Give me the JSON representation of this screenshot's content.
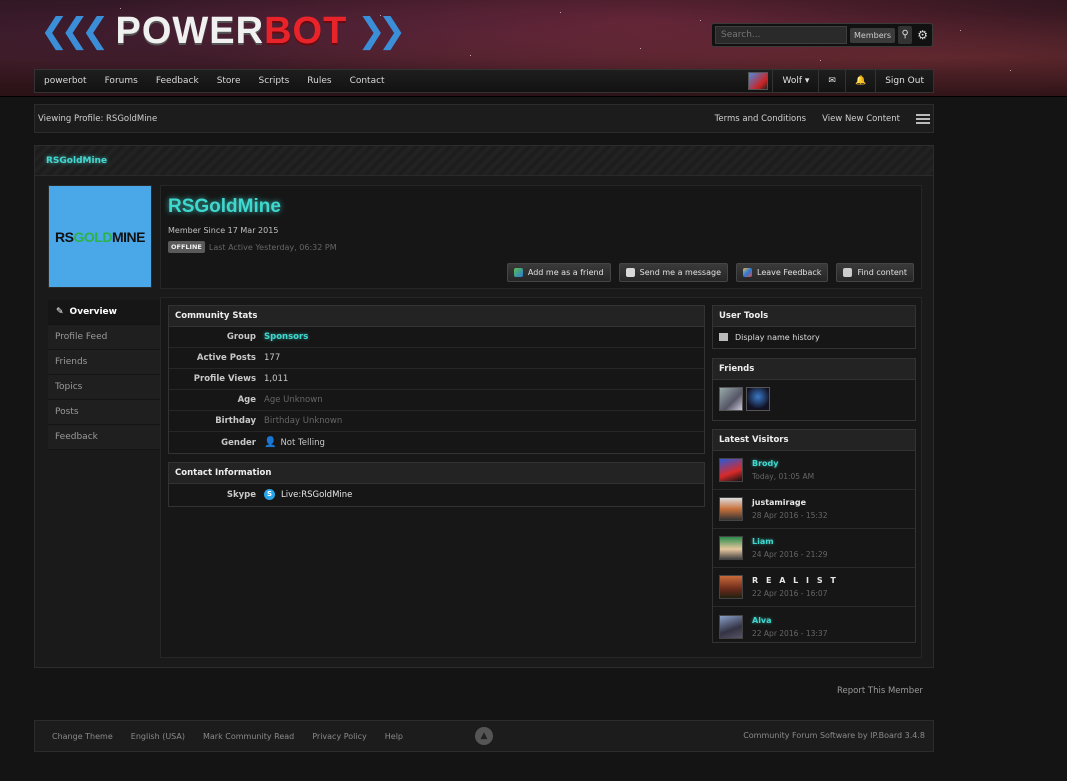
{
  "header": {
    "logo_left": "POWER",
    "logo_right": "BOT",
    "search_placeholder": "Search...",
    "search_scope": "Members"
  },
  "nav": {
    "items": [
      "powerbot",
      "Forums",
      "Feedback",
      "Store",
      "Scripts",
      "Rules",
      "Contact"
    ],
    "user": "Wolf",
    "sign_out": "Sign Out"
  },
  "breadcrumb": {
    "current": "Viewing Profile: RSGoldMine",
    "links": [
      "Terms and Conditions",
      "View New Content"
    ]
  },
  "profile": {
    "panel_title": "RSGoldMine",
    "name": "RSGoldMine",
    "member_since": "Member Since 17 Mar 2015",
    "status_badge": "OFFLINE",
    "last_active": "Last Active Yesterday, 06:32 PM",
    "photo_text_a": "RS",
    "photo_text_b": "GOLD",
    "photo_text_c": "MINE",
    "actions": [
      "Add me as a friend",
      "Send me a message",
      "Leave Feedback",
      "Find content"
    ]
  },
  "tabs": [
    "Overview",
    "Profile Feed",
    "Friends",
    "Topics",
    "Posts",
    "Feedback"
  ],
  "community_stats": {
    "title": "Community Stats",
    "rows": [
      {
        "k": "Group",
        "v": "Sponsors"
      },
      {
        "k": "Active Posts",
        "v": "177"
      },
      {
        "k": "Profile Views",
        "v": "1,011"
      },
      {
        "k": "Age",
        "v": "Age Unknown"
      },
      {
        "k": "Birthday",
        "v": "Birthday Unknown"
      },
      {
        "k": "Gender",
        "v": "Not Telling"
      }
    ]
  },
  "contact": {
    "title": "Contact Information",
    "skype_label": "Skype",
    "skype_value": "Live:RSGoldMine"
  },
  "user_tools": {
    "title": "User Tools",
    "item": "Display name history"
  },
  "friends_box": {
    "title": "Friends"
  },
  "visitors": {
    "title": "Latest Visitors",
    "items": [
      {
        "name": "Brody",
        "time": "Today, 01:05 AM"
      },
      {
        "name": "justamirage",
        "time": "28 Apr 2016 - 15:32"
      },
      {
        "name": "Liam",
        "time": "24 Apr 2016 - 21:29"
      },
      {
        "name": "R E A L I S T",
        "time": "22 Apr 2016 - 16:07"
      },
      {
        "name": "Alva",
        "time": "22 Apr 2016 - 13:37"
      }
    ]
  },
  "report": "Report This Member",
  "footer": {
    "links": [
      "Change Theme",
      "English (USA)",
      "Mark Community Read",
      "Privacy Policy",
      "Help"
    ],
    "credit": "Community Forum Software by IP.Board 3.4.8"
  },
  "colors": {
    "accent_teal": "#3fd8cf",
    "logo_red": "#e8242a",
    "logo_blue": "#3a8fd8"
  }
}
